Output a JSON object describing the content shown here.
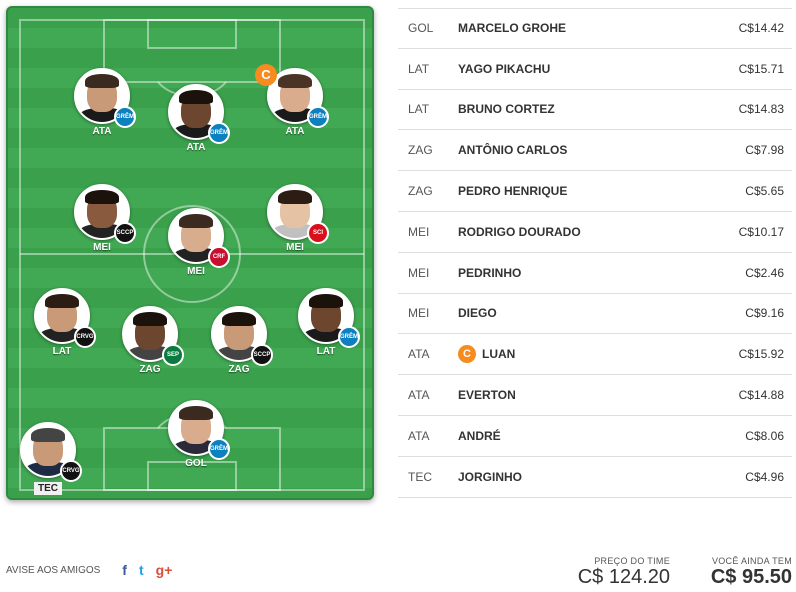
{
  "lineup": [
    {
      "id": "ata1",
      "pos": "ATA",
      "club": "GRÊMIO",
      "club_color": "#0d80bf",
      "skin": "#c89a78",
      "hair": "#3a2a1f",
      "shirt": "#1a1a1a",
      "captain": false
    },
    {
      "id": "ata2",
      "pos": "ATA",
      "club": "GRÊMIO",
      "club_color": "#0d80bf",
      "skin": "#6d4630",
      "hair": "#1c120c",
      "shirt": "#1a1a1a",
      "captain": false
    },
    {
      "id": "ata3",
      "pos": "ATA",
      "club": "GRÊMIO",
      "club_color": "#0d80bf",
      "skin": "#d8ac8c",
      "hair": "#4a3426",
      "shirt": "#1a1a1a",
      "captain": true,
      "captain_label": "C"
    },
    {
      "id": "mei1",
      "pos": "MEI",
      "club": "SCCP",
      "club_color": "#111111",
      "skin": "#8a5a3e",
      "hair": "#1c120c",
      "shirt": "#222222",
      "captain": false
    },
    {
      "id": "mei2",
      "pos": "MEI",
      "club": "CRF",
      "club_color": "#c8102e",
      "skin": "#d7ad8e",
      "hair": "#3a2a1f",
      "shirt": "#222222",
      "captain": false
    },
    {
      "id": "mei3",
      "pos": "MEI",
      "club": "SCI",
      "club_color": "#d8101e",
      "skin": "#e6c2a4",
      "hair": "#2b1d13",
      "shirt": "#c0c0c0",
      "captain": false
    },
    {
      "id": "lat1",
      "pos": "LAT",
      "club": "CRVG",
      "club_color": "#111111",
      "skin": "#c89a78",
      "hair": "#2b1d13",
      "shirt": "#222222",
      "captain": false
    },
    {
      "id": "zag1",
      "pos": "ZAG",
      "club": "SEP",
      "club_color": "#0b7a3e",
      "skin": "#6d4630",
      "hair": "#1c120c",
      "shirt": "#444444",
      "captain": false
    },
    {
      "id": "zag2",
      "pos": "ZAG",
      "club": "SCCP",
      "club_color": "#111111",
      "skin": "#c89a78",
      "hair": "#1c120c",
      "shirt": "#444444",
      "captain": false
    },
    {
      "id": "lat2",
      "pos": "LAT",
      "club": "GRÊMIO",
      "club_color": "#0d80bf",
      "skin": "#6d4630",
      "hair": "#1c120c",
      "shirt": "#1a1a1a",
      "captain": false
    },
    {
      "id": "gol",
      "pos": "GOL",
      "club": "GRÊMIO",
      "club_color": "#0d80bf",
      "skin": "#d8ac8c",
      "hair": "#3a2a1f",
      "shirt": "#2a2a3a",
      "captain": false
    },
    {
      "id": "tec",
      "pos": "TEC",
      "club": "CRVG",
      "club_color": "#111111",
      "skin": "#c89a78",
      "hair": "#444444",
      "shirt": "#1f2a44",
      "captain": false
    }
  ],
  "players": [
    {
      "pos": "GOL",
      "name": "MARCELO GROHE",
      "price": "C$14.42",
      "captain": false
    },
    {
      "pos": "LAT",
      "name": "YAGO PIKACHU",
      "price": "C$15.71",
      "captain": false
    },
    {
      "pos": "LAT",
      "name": "BRUNO CORTEZ",
      "price": "C$14.83",
      "captain": false
    },
    {
      "pos": "ZAG",
      "name": "ANTÔNIO CARLOS",
      "price": "C$7.98",
      "captain": false
    },
    {
      "pos": "ZAG",
      "name": "PEDRO HENRIQUE",
      "price": "C$5.65",
      "captain": false
    },
    {
      "pos": "MEI",
      "name": "RODRIGO DOURADO",
      "price": "C$10.17",
      "captain": false
    },
    {
      "pos": "MEI",
      "name": "PEDRINHO",
      "price": "C$2.46",
      "captain": false
    },
    {
      "pos": "MEI",
      "name": "DIEGO",
      "price": "C$9.16",
      "captain": false
    },
    {
      "pos": "ATA",
      "name": "LUAN",
      "price": "C$15.92",
      "captain": true,
      "captain_label": "C"
    },
    {
      "pos": "ATA",
      "name": "EVERTON",
      "price": "C$14.88",
      "captain": false
    },
    {
      "pos": "ATA",
      "name": "ANDRÉ",
      "price": "C$8.06",
      "captain": false
    },
    {
      "pos": "TEC",
      "name": "JORGINHO",
      "price": "C$4.96",
      "captain": false
    }
  ],
  "share": {
    "label": "AVISE AOS AMIGOS",
    "facebook": "f",
    "twitter": "t",
    "google": "g+"
  },
  "totals": {
    "team_price_label": "PREÇO DO TIME",
    "team_price": "C$ 124.20",
    "remaining_label": "VOCÊ AINDA TEM",
    "remaining": "C$ 95.50"
  },
  "colors": {
    "captain": "#f68b1f",
    "field": "#3aa04c",
    "accent_blue": "#3b5998",
    "twitter": "#1da1f2",
    "google": "#dd4b39"
  }
}
